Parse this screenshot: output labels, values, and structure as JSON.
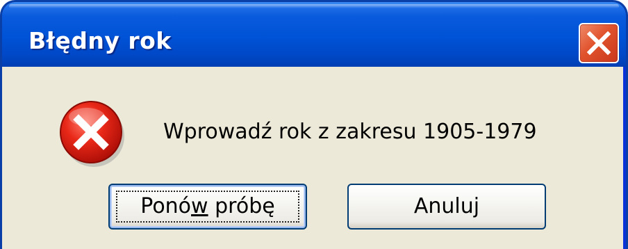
{
  "window": {
    "title": "Błędny rok",
    "close_icon": "close-icon"
  },
  "dialog": {
    "icon": "error-icon",
    "message": "Wprowadź rok z zakresu 1905-1979"
  },
  "buttons": {
    "retry": {
      "label_before": "Pon",
      "label_mnemonic": "ó",
      "label_mnemonic_display": "w",
      "label_after": " próbę",
      "label": "Ponów próbę"
    },
    "cancel": {
      "label": "Anuluj"
    }
  },
  "colors": {
    "titlebar": "#0052d6",
    "close_button": "#e0522c",
    "body": "#ece9d8",
    "error_icon": "#e02020"
  }
}
